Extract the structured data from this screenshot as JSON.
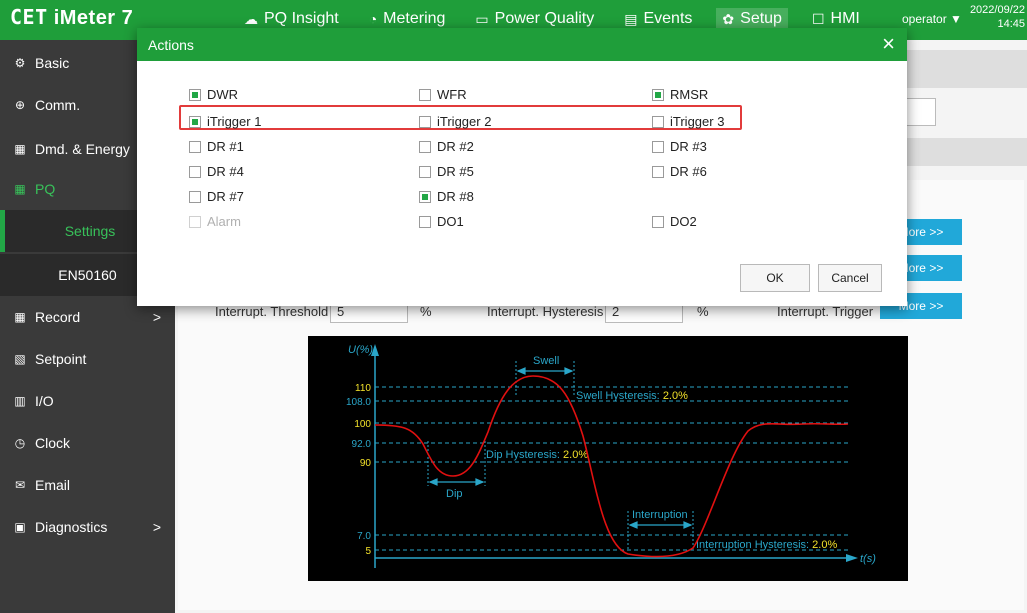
{
  "app": {
    "logo": "CET",
    "product": "iMeter 7",
    "user": "operator",
    "date": "2022/09/22",
    "time": "14:45"
  },
  "nav": [
    {
      "icon": "pq-insight-icon",
      "label": "PQ Insight"
    },
    {
      "icon": "metering-icon",
      "label": "Metering"
    },
    {
      "icon": "power-quality-icon",
      "label": "Power Quality"
    },
    {
      "icon": "events-icon",
      "label": "Events"
    },
    {
      "icon": "setup-icon",
      "label": "Setup",
      "active": true
    },
    {
      "icon": "hmi-icon",
      "label": "HMI"
    }
  ],
  "sidebar": {
    "items": [
      {
        "icon": "basic-icon",
        "label": "Basic"
      },
      {
        "icon": "comm-icon",
        "label": "Comm."
      },
      {
        "icon": "energy-icon",
        "label": "Dmd. & Energy"
      },
      {
        "icon": "pq-icon",
        "label": "PQ",
        "active": true
      },
      {
        "icon": "record-icon",
        "label": "Record",
        "chevron": ">"
      },
      {
        "icon": "setpoint-icon",
        "label": "Setpoint"
      },
      {
        "icon": "io-icon",
        "label": "I/O"
      },
      {
        "icon": "clock-icon",
        "label": "Clock"
      },
      {
        "icon": "email-icon",
        "label": "Email"
      },
      {
        "icon": "diagnostics-icon",
        "label": "Diagnostics",
        "chevron": ">"
      }
    ],
    "subitems": [
      {
        "label": "Settings",
        "active": true
      },
      {
        "label": "EN50160"
      }
    ]
  },
  "content": {
    "interrupt_threshold_label": "Interrupt. Threshold",
    "interrupt_threshold_value": "5",
    "interrupt_threshold_unit": "%",
    "interrupt_hysteresis_label": "Interrupt. Hysteresis",
    "interrupt_hysteresis_value": "2",
    "interrupt_hysteresis_unit": "%",
    "interrupt_trigger_label": "Interrupt. Trigger",
    "more_label": "More >>"
  },
  "chart_data": {
    "type": "line",
    "title": "",
    "ylabel": "U(%)",
    "xlabel": "t(s)",
    "yticks": [
      "110",
      "108.0",
      "100",
      "92.0",
      "90",
      "7.0",
      "5"
    ],
    "annotations": {
      "swell": "Swell",
      "dip": "Dip",
      "interruption": "Interruption",
      "swell_hysteresis_label": "Swell Hysteresis:",
      "swell_hysteresis_value": "2.0%",
      "dip_hysteresis_label": "Dip Hysteresis:",
      "dip_hysteresis_value": "2.0%",
      "interruption_hysteresis_label": "Interruption Hysteresis:",
      "interruption_hysteresis_value": "2.0%"
    },
    "colors": {
      "curve": "#e01010",
      "guides": "#2aa6c9",
      "highlight_ticks": "#f2e12a"
    }
  },
  "modal": {
    "title": "Actions",
    "close": "×",
    "ok": "OK",
    "cancel": "Cancel",
    "options": [
      {
        "label": "DWR",
        "checked": true
      },
      {
        "label": "WFR",
        "checked": false
      },
      {
        "label": "RMSR",
        "checked": true
      },
      {
        "label": "iTrigger 1",
        "checked": true
      },
      {
        "label": "iTrigger 2",
        "checked": false
      },
      {
        "label": "iTrigger 3",
        "checked": false
      },
      {
        "label": "DR #1",
        "checked": false
      },
      {
        "label": "DR #2",
        "checked": false
      },
      {
        "label": "DR #3",
        "checked": false
      },
      {
        "label": "DR #4",
        "checked": false
      },
      {
        "label": "DR #5",
        "checked": false
      },
      {
        "label": "DR #6",
        "checked": false
      },
      {
        "label": "DR #7",
        "checked": false
      },
      {
        "label": "DR #8",
        "checked": true
      },
      null,
      {
        "label": "Alarm",
        "checked": false,
        "disabled": true
      },
      {
        "label": "DO1",
        "checked": false
      },
      {
        "label": "DO2",
        "checked": false
      }
    ]
  },
  "colors": {
    "brand_green": "#1f9e3a",
    "sidebar_bg": "#3a3a3a",
    "accent_blue": "#21a8d9",
    "highlight_red": "#e23b3b"
  }
}
